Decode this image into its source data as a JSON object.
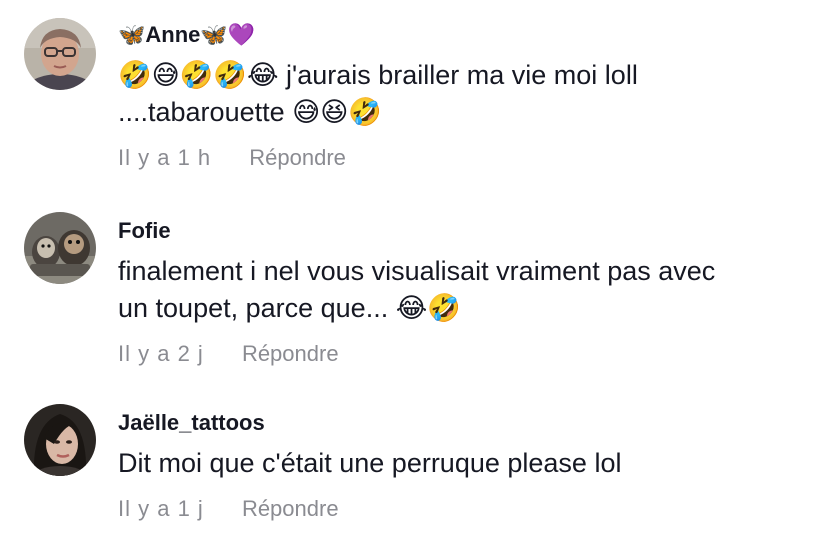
{
  "comments": [
    {
      "username": "🦋Anne🦋💜",
      "text_lines": [
        "🤣😅🤣🤣😂 j'aurais brailler ma vie moi loll",
        "....tabarouette 😅😆🤣"
      ],
      "time": "Il y a 1 h",
      "reply_label": "Répondre"
    },
    {
      "username": "Fofie",
      "text_lines": [
        "finalement i nel vous visualisait vraiment pas avec",
        "un toupet, parce que... 😂🤣"
      ],
      "time": "Il y a 2 j",
      "reply_label": "Répondre"
    },
    {
      "username": "Jaëlle_tattoos",
      "text_lines": [
        "Dit moi que c'était une perruque please lol"
      ],
      "time": "Il y a 1 j",
      "reply_label": "Répondre"
    }
  ]
}
